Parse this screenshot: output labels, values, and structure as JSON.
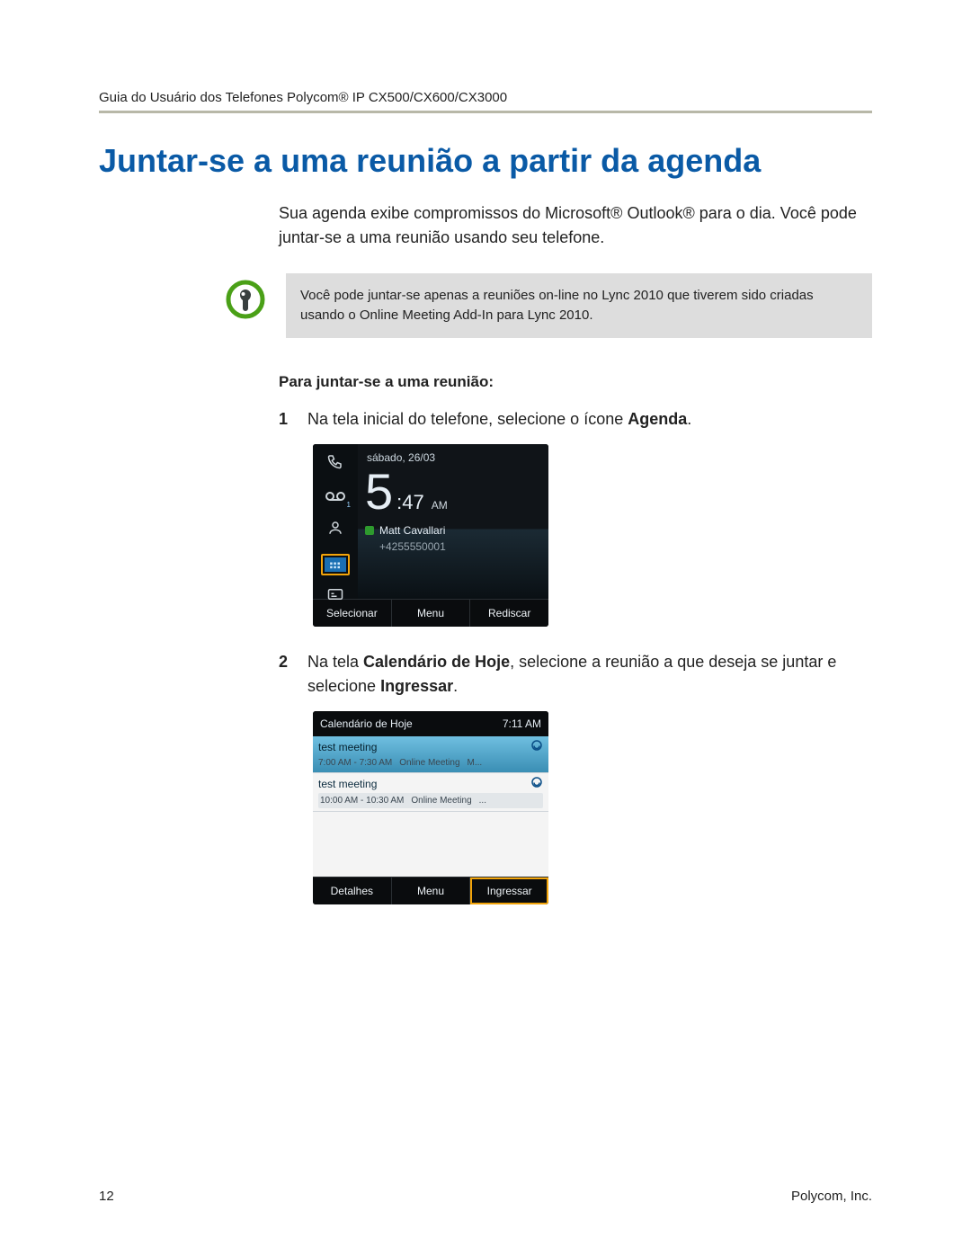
{
  "header": {
    "breadcrumb": "Guia do Usuário dos Telefones Polycom® IP CX500/CX600/CX3000"
  },
  "title": "Juntar-se a uma reunião a partir da agenda",
  "intro": "Sua agenda exibe compromissos do Microsoft® Outlook® para o dia. Você pode juntar-se a uma reunião usando seu telefone.",
  "note": "Você pode juntar-se apenas a reuniões on-line no Lync 2010 que tiverem sido criadas usando o Online Meeting Add-In para Lync 2010.",
  "steps_heading": "Para juntar-se a uma reunião:",
  "steps": {
    "s1": {
      "num": "1",
      "prefix": "Na tela inicial do telefone, selecione o ícone ",
      "bold": "Agenda",
      "suffix": "."
    },
    "s2": {
      "num": "2",
      "prefix": "Na tela ",
      "bold1": "Calendário de Hoje",
      "mid": ", selecione a reunião a que deseja se juntar e selecione ",
      "bold2": "Ingressar",
      "suffix": "."
    }
  },
  "phone1": {
    "date": "sábado, 26/03",
    "time_h": "5",
    "time_m": ":47",
    "ampm": "AM",
    "user": "Matt Cavallari",
    "number": "+4255550001",
    "softkeys": [
      "Selecionar",
      "Menu",
      "Rediscar"
    ],
    "voicemail_badge": "1"
  },
  "phone2": {
    "title": "Calendário de Hoje",
    "clock": "7:11 AM",
    "items": [
      {
        "name": "test meeting",
        "time": "7:00 AM - 7:30 AM",
        "type": "Online Meeting",
        "loc": "M..."
      },
      {
        "name": "test meeting",
        "time": "10:00 AM - 10:30 AM",
        "type": "Online Meeting",
        "loc": "..."
      }
    ],
    "softkeys": [
      "Detalhes",
      "Menu",
      "Ingressar"
    ]
  },
  "footer": {
    "page": "12",
    "company": "Polycom, Inc."
  }
}
